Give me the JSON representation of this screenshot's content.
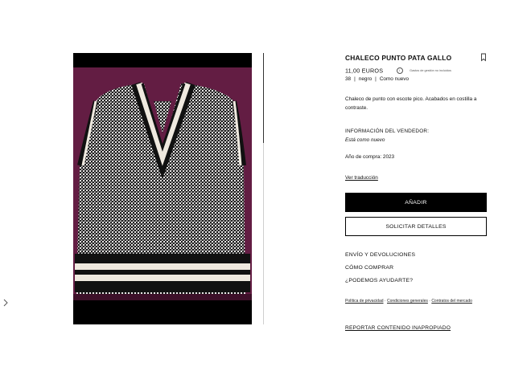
{
  "product": {
    "title": "CHALECO PUNTO PATA GALLO",
    "price": "11,00 EUROS",
    "fees_note": "Gastos de gestión no incluidos",
    "size": "38",
    "color": "negro",
    "condition": "Como nuevo",
    "description": "Chaleco de punto con escote pico. Acabados en costilla a contraste."
  },
  "seller": {
    "heading": "INFORMACIÓN DEL VENDEDOR:",
    "note": "Está como nuevo",
    "purchase_year": "Año de compra: 2023"
  },
  "actions": {
    "translate": "Ver traducción",
    "add": "AÑADIR",
    "details": "SOLICITAR DETALLES"
  },
  "help_links": [
    "ENVÍO Y DEVOLUCIONES",
    "CÓMO COMPRAR",
    "¿PODEMOS AYUDARTE?"
  ],
  "legal": {
    "privacy": "Política de privacidad",
    "conditions": "Condiciones generales",
    "contracts": "Contratos del mercado"
  },
  "report": "REPORTAR CONTENIDO INAPROPIADO",
  "icons": [
    "chevron-right-icon",
    "bookmark-icon",
    "info-icon"
  ],
  "colors": {
    "primary": "#000000",
    "background": "#ffffff",
    "photo_backdrop": "#5c1a3f"
  }
}
